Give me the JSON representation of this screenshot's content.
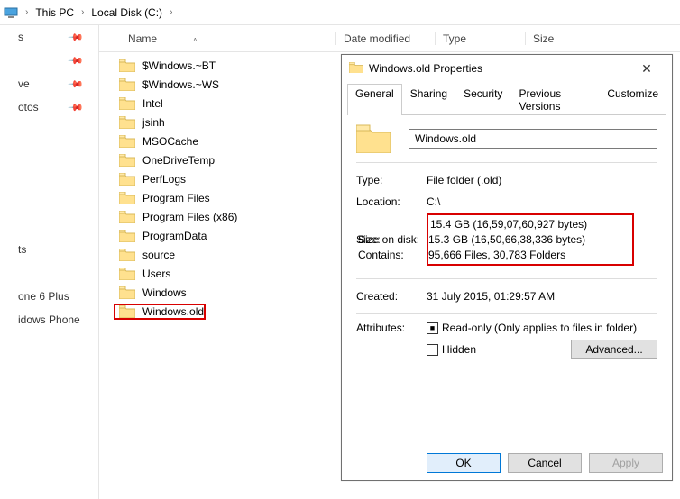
{
  "breadcrumb": {
    "this_pc": "This PC",
    "drive": "Local Disk (C:)"
  },
  "sidebar": {
    "items": [
      "s",
      "",
      "ve",
      "otos",
      "",
      "",
      "",
      "",
      "ts",
      "",
      "one 6 Plus",
      "idows Phone"
    ]
  },
  "columns": {
    "name": "Name",
    "date": "Date modified",
    "type": "Type",
    "size": "Size"
  },
  "files": {
    "items": [
      {
        "name": "$Windows.~BT"
      },
      {
        "name": "$Windows.~WS"
      },
      {
        "name": "Intel"
      },
      {
        "name": "jsinh"
      },
      {
        "name": "MSOCache"
      },
      {
        "name": "OneDriveTemp"
      },
      {
        "name": "PerfLogs"
      },
      {
        "name": "Program Files"
      },
      {
        "name": "Program Files (x86)"
      },
      {
        "name": "ProgramData"
      },
      {
        "name": "source"
      },
      {
        "name": "Users"
      },
      {
        "name": "Windows"
      },
      {
        "name": "Windows.old",
        "highlighted": true
      }
    ]
  },
  "dialog": {
    "title": "Windows.old Properties",
    "tabs": [
      "General",
      "Sharing",
      "Security",
      "Previous Versions",
      "Customize"
    ],
    "folder_name": "Windows.old",
    "type_label": "Type:",
    "type_value": "File folder (.old)",
    "location_label": "Location:",
    "location_value": "C:\\",
    "size_label": "Size:",
    "size_value": "15.4 GB (16,59,07,60,927 bytes)",
    "sizeondisk_label": "Size on disk:",
    "sizeondisk_value": "15.3 GB (16,50,66,38,336 bytes)",
    "contains_label": "Contains:",
    "contains_value": "95,666 Files, 30,783 Folders",
    "created_label": "Created:",
    "created_value": "31 July 2015, 01:29:57 AM",
    "attributes_label": "Attributes:",
    "readonly_label": "Read-only (Only applies to files in folder)",
    "hidden_label": "Hidden",
    "advanced_btn": "Advanced...",
    "ok": "OK",
    "cancel": "Cancel",
    "apply": "Apply"
  }
}
